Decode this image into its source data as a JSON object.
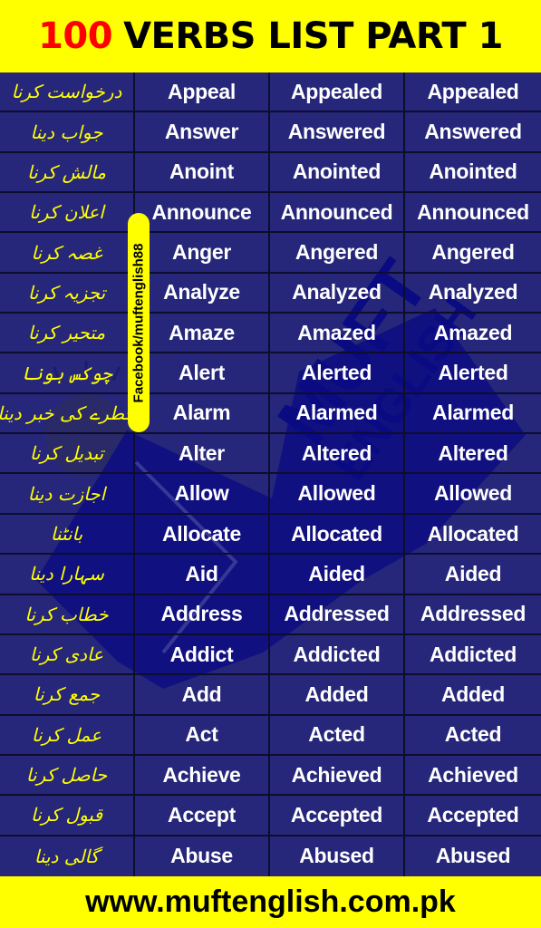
{
  "header": {
    "title_number": "100",
    "title_text": "VERBS LIST PART 1"
  },
  "social": {
    "facebook_handle": "Facebook/muftenglish88"
  },
  "watermark": {
    "line1": "MUFT",
    "line2": "ENGLISH"
  },
  "colors": {
    "background_yellow": "#ffff00",
    "table_blue": "#26267a",
    "urdu_text": "#ffff00",
    "title_number_red": "#ff0000"
  },
  "verbs": [
    {
      "urdu": "درخواست کرنا",
      "base": "Appeal",
      "past": "Appealed",
      "participle": "Appealed"
    },
    {
      "urdu": "جواب دینا",
      "base": "Answer",
      "past": "Answered",
      "participle": "Answered"
    },
    {
      "urdu": "مالش کرنا",
      "base": "Anoint",
      "past": "Anointed",
      "participle": "Anointed"
    },
    {
      "urdu": "اعلان کرنا",
      "base": "Announce",
      "past": "Announced",
      "participle": "Announced"
    },
    {
      "urdu": "غصہ کرنا",
      "base": "Anger",
      "past": "Angered",
      "participle": "Angered"
    },
    {
      "urdu": "تجزیہ کرنا",
      "base": "Analyze",
      "past": "Analyzed",
      "participle": "Analyzed"
    },
    {
      "urdu": "متحیر کرنا",
      "base": "Amaze",
      "past": "Amazed",
      "participle": "Amazed"
    },
    {
      "urdu": "چوکس ہونا",
      "base": "Alert",
      "past": "Alerted",
      "participle": "Alerted"
    },
    {
      "urdu": "خطرے کی خبر دینا",
      "base": "Alarm",
      "past": "Alarmed",
      "participle": "Alarmed"
    },
    {
      "urdu": "تبدیل کرنا",
      "base": "Alter",
      "past": "Altered",
      "participle": "Altered"
    },
    {
      "urdu": "اجازت دینا",
      "base": "Allow",
      "past": "Allowed",
      "participle": "Allowed"
    },
    {
      "urdu": "بانٹنا",
      "base": "Allocate",
      "past": "Allocated",
      "participle": "Allocated"
    },
    {
      "urdu": "سہارا دینا",
      "base": "Aid",
      "past": "Aided",
      "participle": "Aided"
    },
    {
      "urdu": "خطاب کرنا",
      "base": "Address",
      "past": "Addressed",
      "participle": "Addressed"
    },
    {
      "urdu": "عادی کرنا",
      "base": "Addict",
      "past": "Addicted",
      "participle": "Addicted"
    },
    {
      "urdu": "جمع کرنا",
      "base": "Add",
      "past": "Added",
      "participle": "Added"
    },
    {
      "urdu": "عمل کرنا",
      "base": "Act",
      "past": "Acted",
      "participle": "Acted"
    },
    {
      "urdu": "حاصل کرنا",
      "base": "Achieve",
      "past": "Achieved",
      "participle": "Achieved"
    },
    {
      "urdu": "قبول کرنا",
      "base": "Accept",
      "past": "Accepted",
      "participle": "Accepted"
    },
    {
      "urdu": "گالی دینا",
      "base": "Abuse",
      "past": "Abused",
      "participle": "Abused"
    }
  ],
  "footer": {
    "website": "www.muftenglish.com.pk"
  }
}
